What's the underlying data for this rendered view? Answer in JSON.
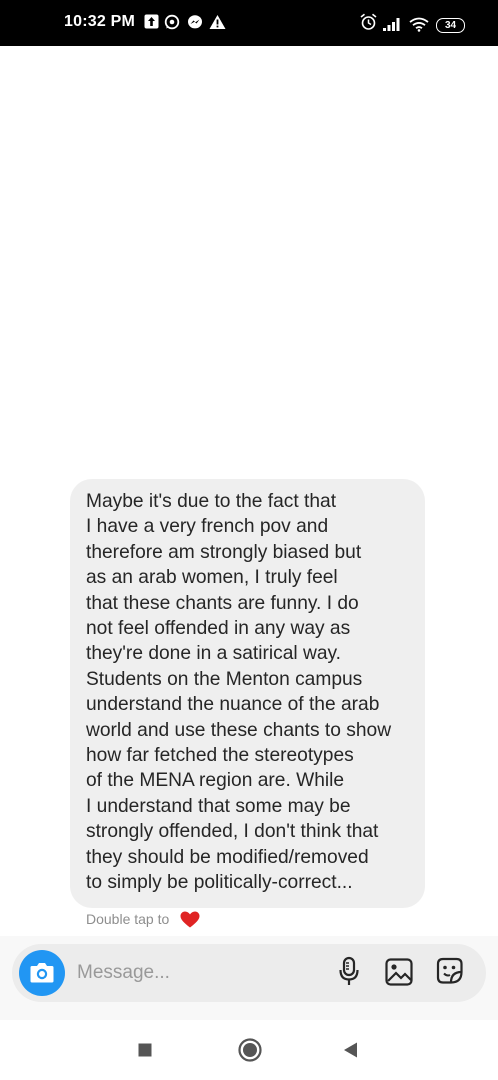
{
  "status_bar": {
    "time": "10:32 PM",
    "battery": "34",
    "left_icons": [
      "upload-icon",
      "whatsapp-icon",
      "messenger-icon",
      "warning-icon"
    ],
    "right_icons": [
      "alarm-icon",
      "signal-icon",
      "wifi-icon",
      "battery-icon"
    ]
  },
  "message": {
    "lines": [
      "Maybe it's due to the fact that",
      "I have a very french pov and",
      "therefore am strongly biased but",
      "as an arab women, I truly feel",
      "that these chants are funny. I do",
      "not feel offended in any way as",
      "they're done in a satirical way.",
      "Students on the Menton campus",
      "understand the nuance of the arab",
      "world and use these chants to show",
      "how far fetched the stereotypes",
      "of the MENA region are. While",
      "I understand that some may be",
      "strongly offended, I don't think that",
      "they should be modified/removed",
      "to simply be politically-correct..."
    ],
    "hint": "Double tap to",
    "heart_color": "#e02424"
  },
  "composer": {
    "placeholder": "Message...",
    "camera_color": "#2196f3",
    "tools": [
      "microphone-icon",
      "gallery-icon",
      "sticker-icon"
    ]
  },
  "nav": {
    "buttons": [
      "recents-button",
      "home-button",
      "back-button"
    ]
  }
}
